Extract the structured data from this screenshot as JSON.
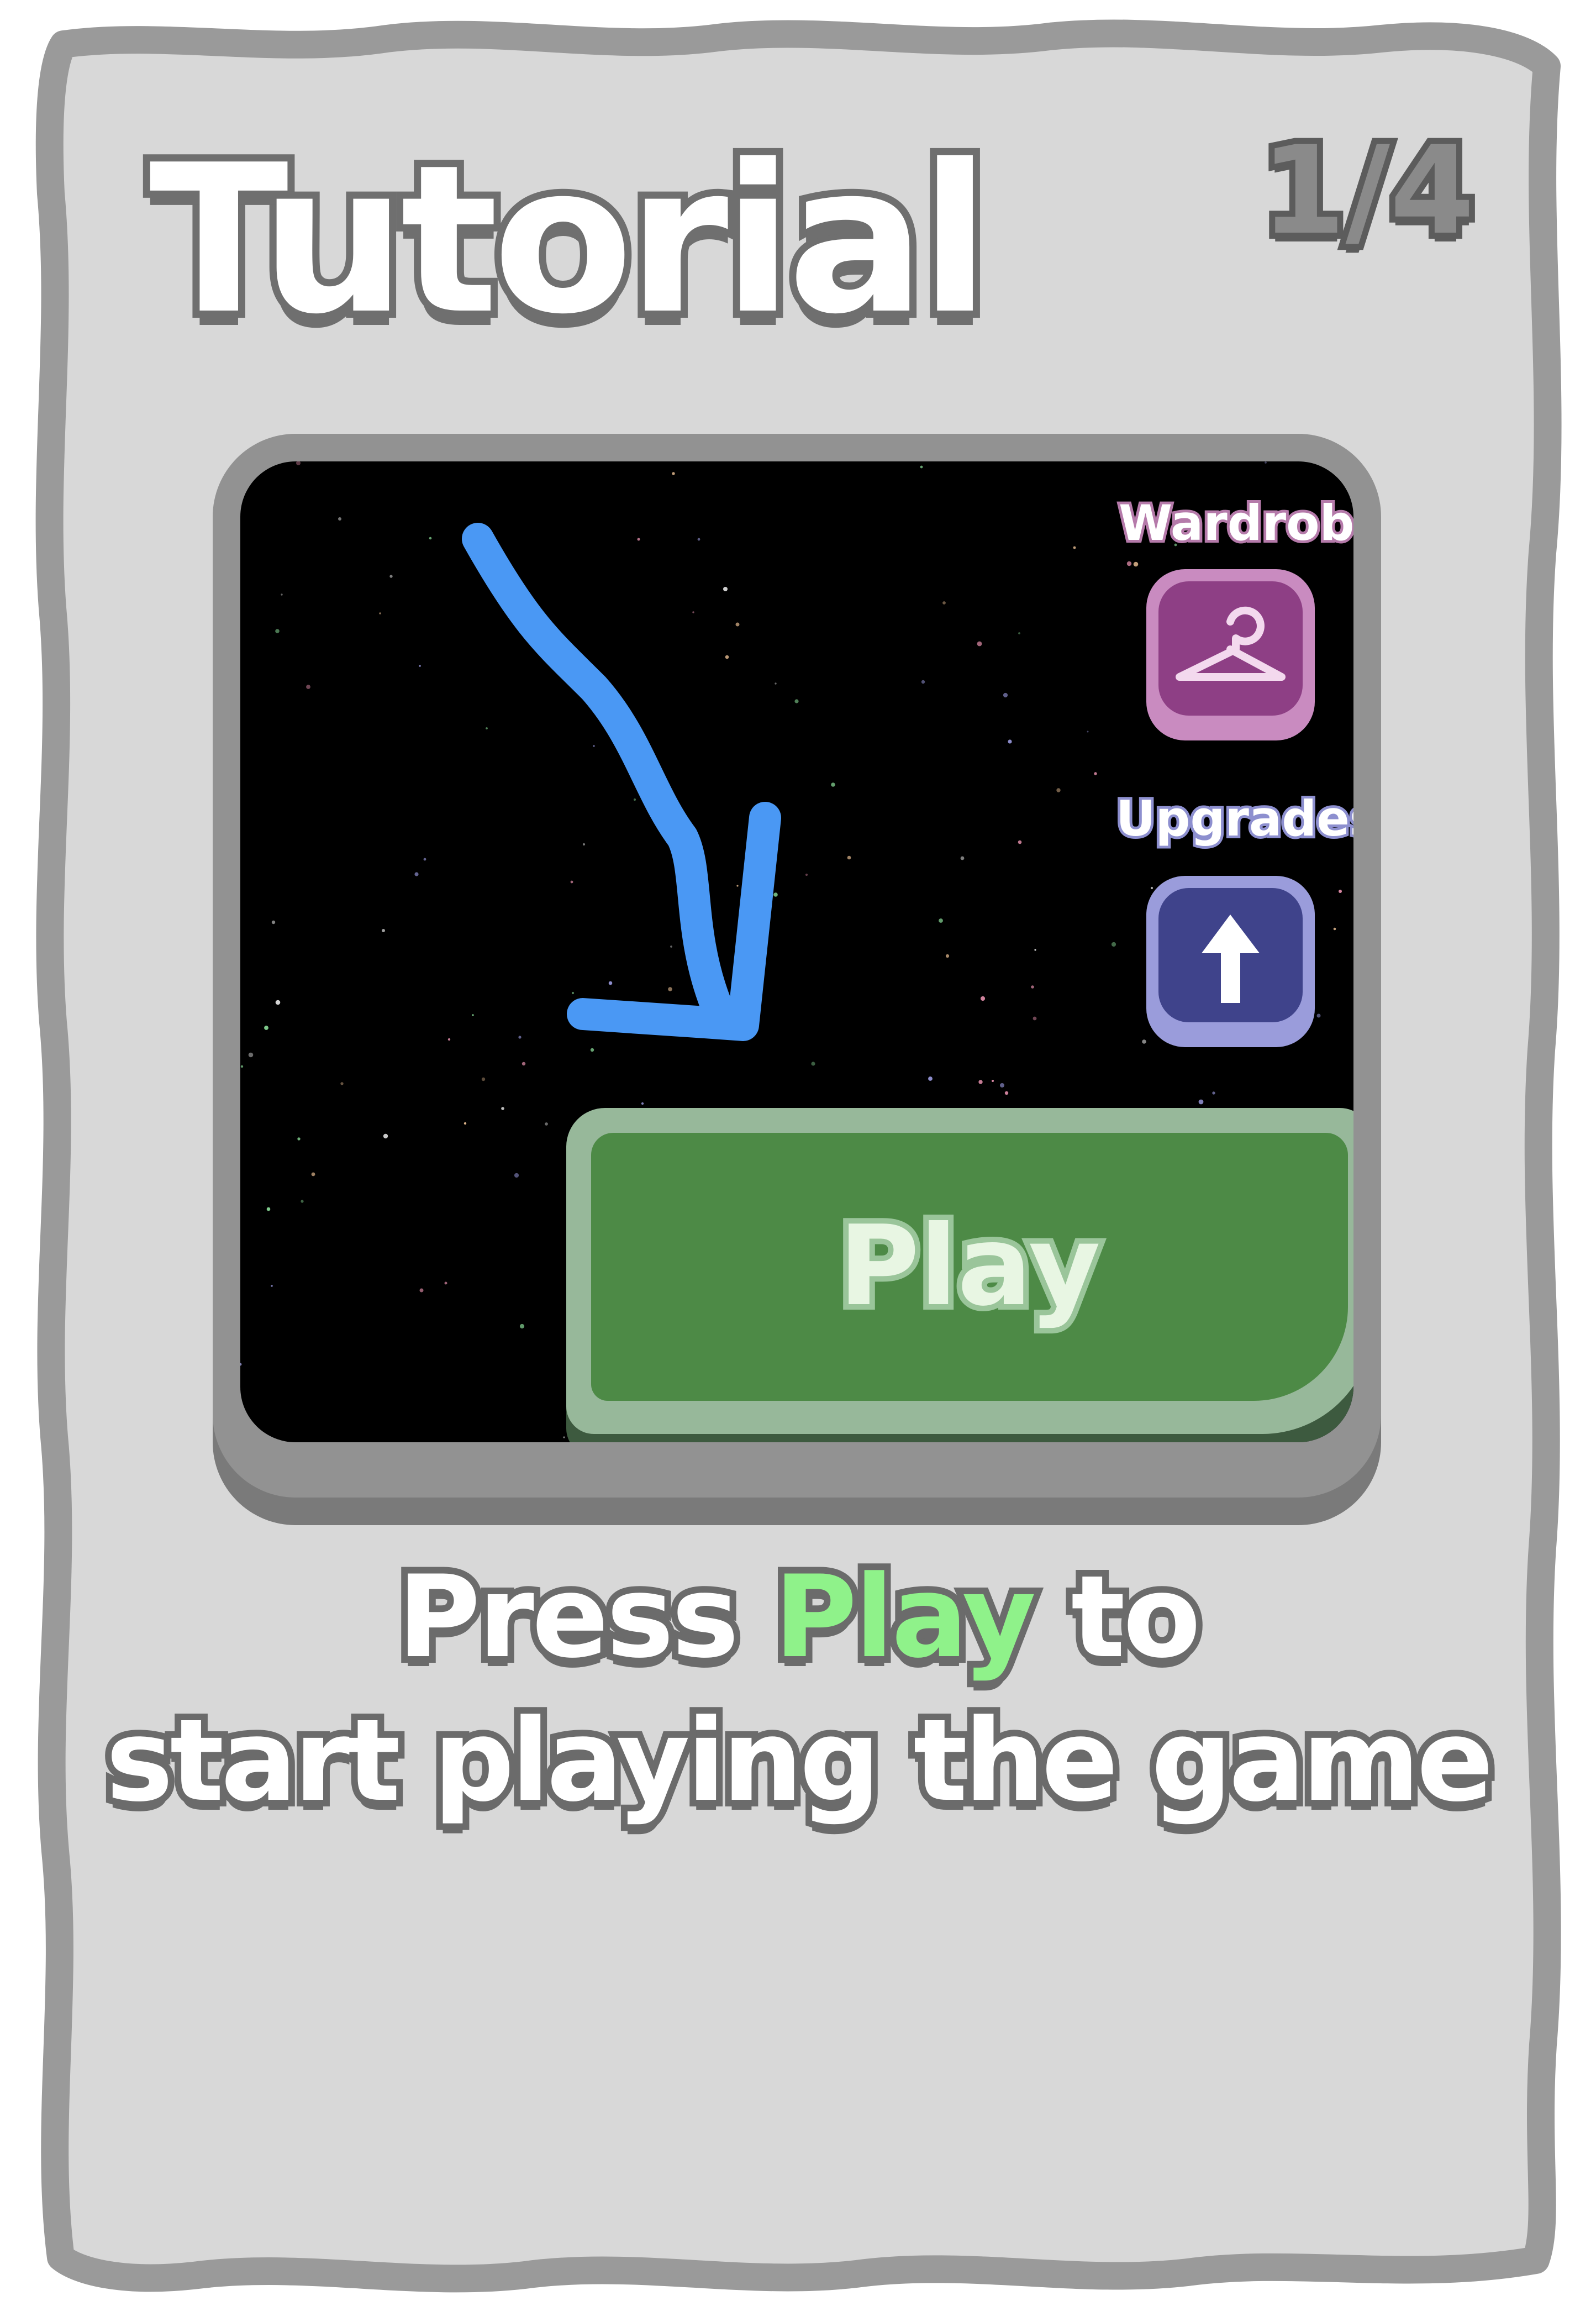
{
  "title": "Tutorial",
  "page_counter": "1/4",
  "screenshot": {
    "wardrobe_label": "Wardrobe",
    "upgrades_label": "Upgrades",
    "play_label": "Play",
    "icons": [
      "hanger-icon",
      "up-arrow-icon",
      "hand-drawn-arrow-icon"
    ]
  },
  "caption": {
    "before_highlight": "Press ",
    "highlight": "Play",
    "after_highlight": " to",
    "line2": "start playing the game"
  },
  "colors": {
    "card": "#d9d9d9",
    "card_border": "#9a9a9a",
    "highlight": "#8ff28a",
    "arrow": "#4a98f4",
    "play_button": "#4d8a46",
    "wardrobe_button": "#8e3f85",
    "upgrades_button": "#3f438b"
  }
}
